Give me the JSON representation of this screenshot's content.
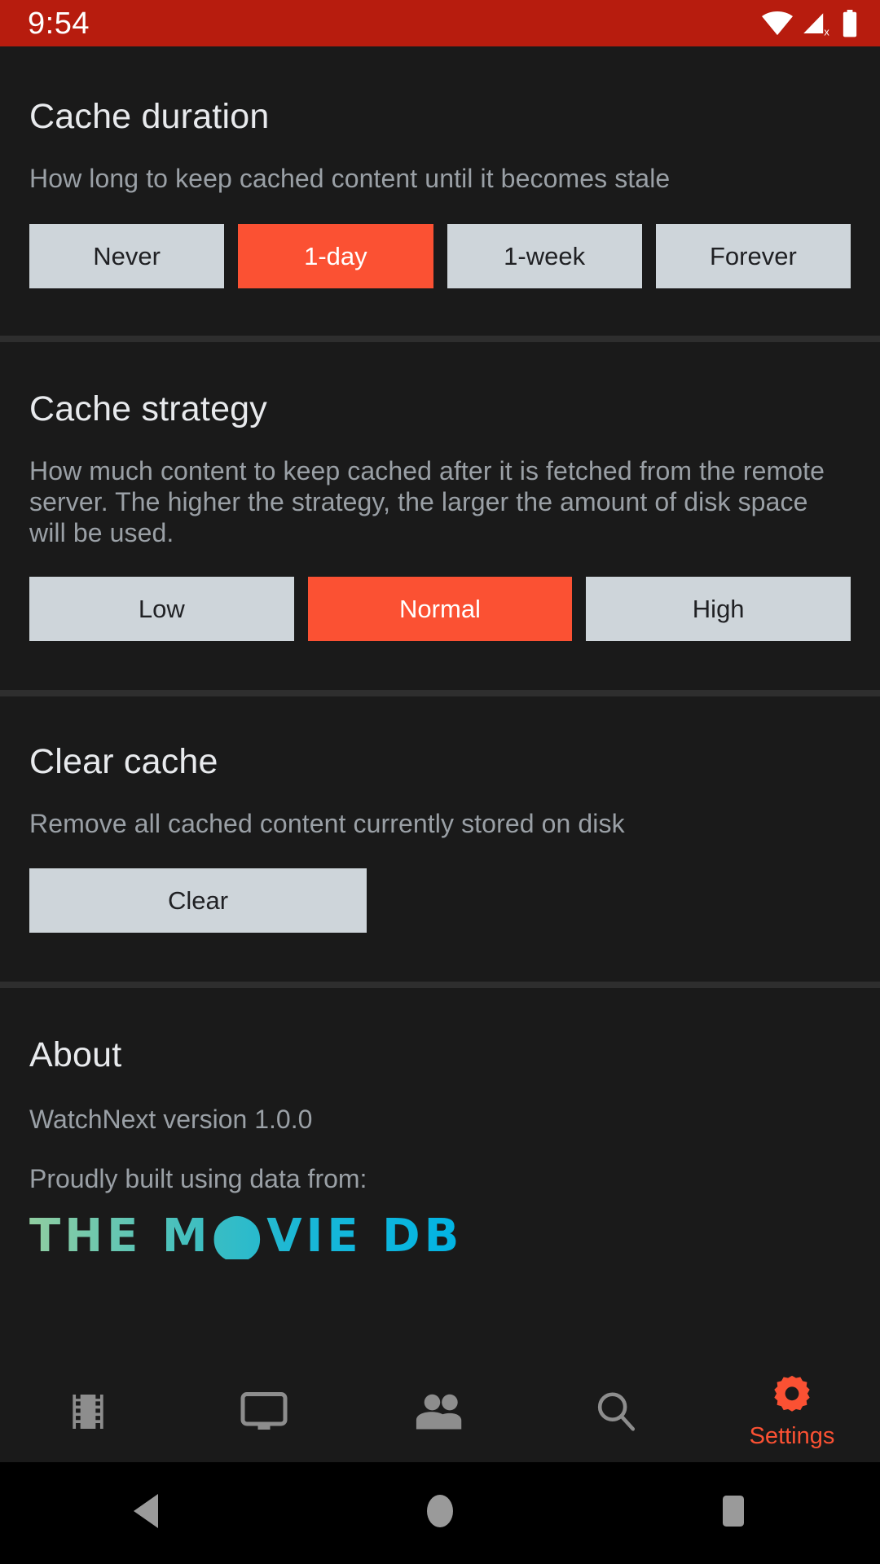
{
  "status_bar": {
    "time": "9:54",
    "icons": [
      "wifi-icon",
      "cellular-off-icon",
      "battery-full-icon"
    ],
    "background_color": "#b71c0e"
  },
  "theme": {
    "background": "#1a1a1a",
    "divider": "#2e2e2e",
    "accent": "#fb5133",
    "chip_background": "#ced5da",
    "chip_text": "#202124",
    "title_text": "#e8eaed",
    "body_text": "#9aa0a6"
  },
  "sections": {
    "cache_duration": {
      "title": "Cache duration",
      "description": "How long to keep cached content until it becomes stale",
      "options": [
        {
          "label": "Never",
          "selected": false
        },
        {
          "label": "1-day",
          "selected": true
        },
        {
          "label": "1-week",
          "selected": false
        },
        {
          "label": "Forever",
          "selected": false
        }
      ]
    },
    "cache_strategy": {
      "title": "Cache strategy",
      "description": "How much content to keep cached after it is fetched from the remote server. The higher the strategy, the larger the amount of disk space will be used.",
      "options": [
        {
          "label": "Low",
          "selected": false
        },
        {
          "label": "Normal",
          "selected": true
        },
        {
          "label": "High",
          "selected": false
        }
      ]
    },
    "clear_cache": {
      "title": "Clear cache",
      "description": "Remove all cached content currently stored on disk",
      "button_label": "Clear"
    },
    "about": {
      "title": "About",
      "version_line": "WatchNext version 1.0.0",
      "attribution_line": "Proudly built using data from:",
      "logo_text": "THE M⬤VIE DB",
      "logo_parts": {
        "the": "THE",
        "m": "M",
        "ovie": "VIE",
        "db": "DB"
      },
      "logo_gradient_start": "#90cea1",
      "logo_gradient_end": "#01b4e4"
    }
  },
  "tab_bar": {
    "items": [
      {
        "icon": "film-strip-icon",
        "label": "",
        "active": false
      },
      {
        "icon": "tv-icon",
        "label": "",
        "active": false
      },
      {
        "icon": "people-icon",
        "label": "",
        "active": false
      },
      {
        "icon": "search-icon",
        "label": "",
        "active": false
      },
      {
        "icon": "gear-icon",
        "label": "Settings",
        "active": true
      }
    ],
    "active_color": "#fb5133",
    "inactive_color": "#8d8d8d"
  },
  "system_nav": {
    "buttons": [
      "back-icon",
      "home-icon",
      "recents-icon"
    ],
    "color": "#9a9a9a"
  }
}
